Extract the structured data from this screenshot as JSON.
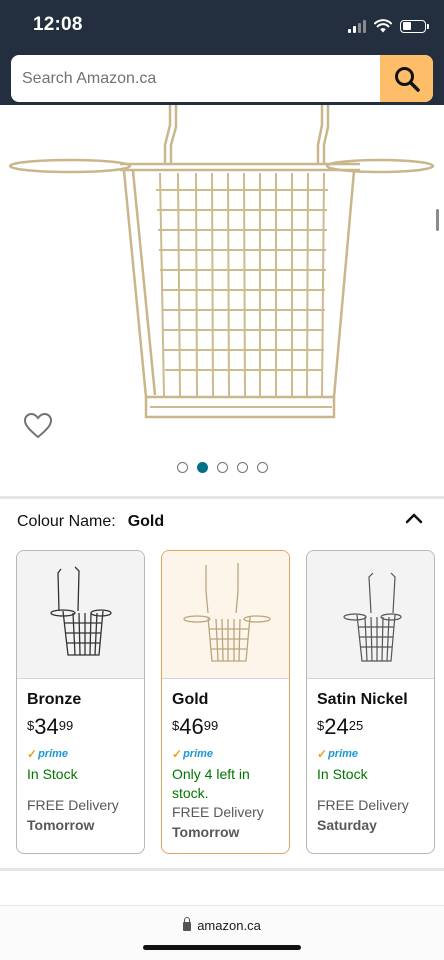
{
  "status": {
    "time": "12:08"
  },
  "search": {
    "placeholder": "Search Amazon.ca"
  },
  "colour_selector": {
    "label": "Colour Name:",
    "value": "Gold"
  },
  "image_carousel": {
    "page_count": 5,
    "active_index": 1
  },
  "variants": [
    {
      "name": "Bronze",
      "price_currency": "$",
      "price_whole": "34",
      "price_fraction": "99",
      "prime": "prime",
      "stock": "In Stock",
      "delivery": "FREE Delivery",
      "delivery_day": "Tomorrow"
    },
    {
      "name": "Gold",
      "price_currency": "$",
      "price_whole": "46",
      "price_fraction": "99",
      "prime": "prime",
      "stock": "Only 4 left in stock.",
      "delivery": "FREE Delivery",
      "delivery_day": "Tomorrow"
    },
    {
      "name": "Satin Nickel",
      "price_currency": "$",
      "price_whole": "24",
      "price_fraction": "25",
      "prime": "prime",
      "stock": "In Stock",
      "delivery": "FREE Delivery",
      "delivery_day": "Saturday"
    }
  ],
  "browser": {
    "url": "amazon.ca"
  },
  "colors": {
    "header": "#232f3e",
    "search_button": "#febd69",
    "stock_green": "#007600",
    "prime_blue": "#1a98d0",
    "dot_active": "#007185",
    "selected_border": "#e2a35a"
  }
}
